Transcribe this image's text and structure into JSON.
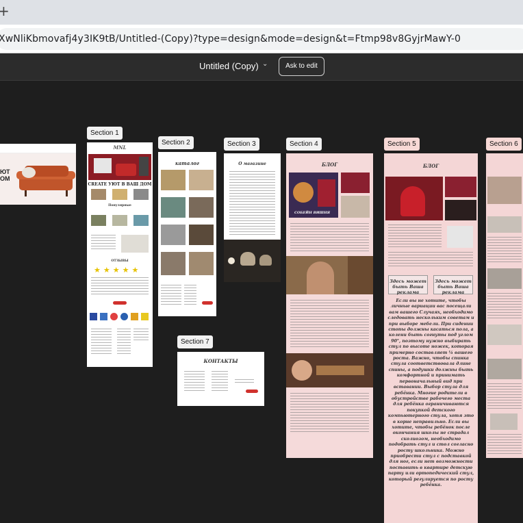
{
  "browser": {
    "new_tab_symbol": "+",
    "url": "XwNliKbmovafj4y3IK9tB/Untitled-(Copy)?type=design&mode=design&t=Ftmp98v8GyjrMawY-0"
  },
  "toolbar": {
    "file_name": "Untitled (Copy)",
    "ask_to_edit": "Ask to edit"
  },
  "sections": {
    "s1": "Section 1",
    "s2": "Section 2",
    "s3": "Section 3",
    "s4": "Section 4",
    "s5": "Section 5",
    "s6": "Section 6",
    "s7": "Section 7"
  },
  "frames": {
    "hero_text": "ЮТ\nОМ",
    "s1_logo": "MNL",
    "s1_heading": "CREATE УЮТ В ВАШ ДОМ",
    "s1_subhead": "Популярные",
    "s1_reviews": "ОТЗЫВЫ",
    "s2_title": "каталог",
    "s3_title": "О магазине",
    "s4_title": "БЛОГ",
    "s4_caption": "СОБЕЙН ВИШНЯ",
    "s5_title": "БЛОГ",
    "s5_ad_1": "Здесь может быть Ваша реклама",
    "s5_ad_2": "Здесь может быть Ваша реклама",
    "s5_body": "Если вы не хотите, чтобы личные вариации вас посещали вам вашего Случаях, необходимо следовать нескольким советам и при выборе мебели. При сидении стопы должны касаться пола, а колени быть согнуты под углом 90°, поэтому нужно выбирать стул по высоте ножек, которая примерно составляет ¼ вашего роста. Важно, чтобы спинка стула соответствовала длине спины, а подушки должны быть комфортной и принимать первоначальный вид при вставании. Выбор стула для ребёнка. Многие родители в обустройстве рабочего места для ребёнка ограничиваются покупкой детского компьютерного стула, хотя это в корне неправильно. Если вы хотите, чтобы ребёнок после окончания школы не страдал сколиозом, необходимо подобрать стул и стол согласно росту школьника. Можно приобрести стул с подставкой для ног, если нет возможности поставить в квартире детскую парту или ортопедический стул, который регулируется по росту ребёнка.",
    "s7_title": "КОНТАКТЫ"
  },
  "colors": {
    "canvas": "#1e1e1e",
    "toolbar": "#2c2c2c",
    "frame_pink": "#f4d6d6",
    "label_pink": "#f7d9d6",
    "accent_red": "#d0312d",
    "star": "#e6c200"
  }
}
